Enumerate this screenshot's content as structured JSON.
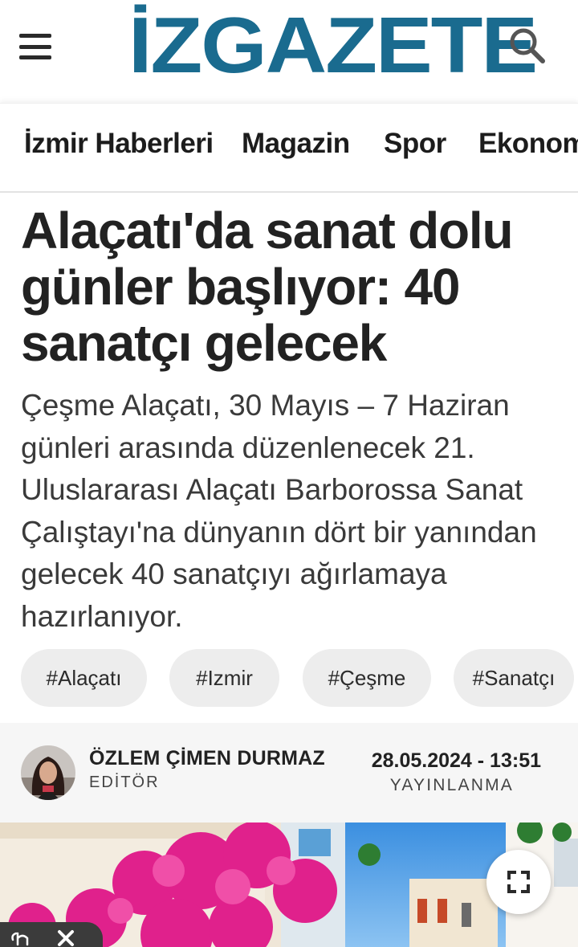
{
  "header": {
    "logo_text": "İZGAZETE",
    "brand_color": "#1a6b8f"
  },
  "nav": {
    "items": [
      {
        "label": "İzmir Haberleri"
      },
      {
        "label": "Magazin"
      },
      {
        "label": "Spor"
      },
      {
        "label": "Ekonomi"
      }
    ]
  },
  "article": {
    "title": "Alaçatı'da sanat dolu günler başlıyor: 40 sanatçı gelecek",
    "summary": "Çeşme Alaçatı, 30 Mayıs – 7 Haziran günleri arasında düzenlenecek 21. Uluslararası Alaçatı Barborossa Sanat Çalıştayı'na dünyanın dört bir yanından gelecek 40 sanatçıyı ağırlamaya hazırlanıyor.",
    "tags": [
      "#Alaçatı",
      "#Izmir",
      "#Çeşme",
      "#Sanatçı"
    ]
  },
  "author": {
    "name": "ÖZLEM ÇİMEN DURMAZ",
    "role": "EDİTÖR"
  },
  "publish": {
    "datetime": "28.05.2024 - 13:51",
    "label": "YAYINLANMA"
  },
  "icons": {
    "menu": "hamburger-icon",
    "search": "search-icon",
    "expand": "fullscreen-icon",
    "close": "close-icon"
  }
}
